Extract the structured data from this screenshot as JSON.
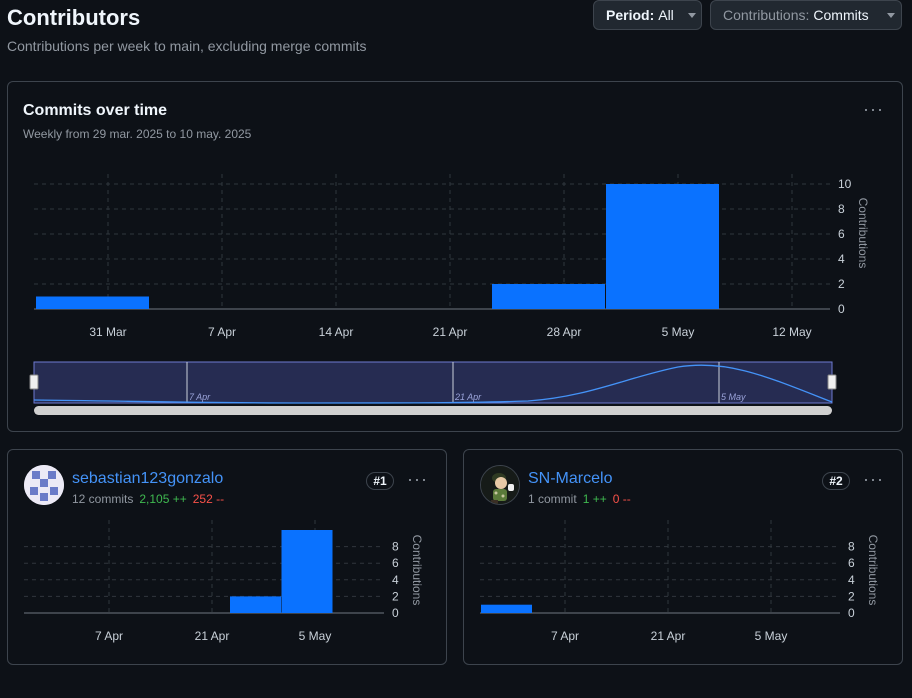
{
  "header": {
    "title": "Contributors",
    "subtitle": "Contributions per week to main, excluding merge commits",
    "period_label": "Period:",
    "period_value": "All",
    "contrib_label": "Contributions:",
    "contrib_value": "Commits"
  },
  "overview": {
    "title": "Commits over time",
    "subtitle": "Weekly from 29 mar. 2025 to 10 may. 2025",
    "more_icon": "kebab-horizontal-icon"
  },
  "chart_data": [
    {
      "type": "bar",
      "title": "Commits over time",
      "categories": [
        "31 Mar",
        "7 Apr",
        "14 Apr",
        "21 Apr",
        "28 Apr",
        "5 May"
      ],
      "values": [
        1,
        0,
        0,
        0,
        2,
        10
      ],
      "x_tick_labels": [
        "31 Mar",
        "7 Apr",
        "14 Apr",
        "21 Apr",
        "28 Apr",
        "5 May",
        "12 May"
      ],
      "y_ticks": [
        0,
        2,
        4,
        6,
        8,
        10
      ],
      "ylabel": "Contributions",
      "ylim": [
        0,
        10
      ],
      "grid": true,
      "navigator_labels": [
        "7 Apr",
        "21 Apr",
        "5 May"
      ],
      "bar_color": "#0a72ff"
    },
    {
      "type": "bar",
      "title": "",
      "contributor": "sebastian123gonzalo",
      "x_tick_labels": [
        "7 Apr",
        "21 Apr",
        "5 May"
      ],
      "values": [
        0,
        0,
        0,
        0,
        2,
        10
      ],
      "y_ticks": [
        0,
        2,
        4,
        6,
        8
      ],
      "ylabel": "Contributions",
      "ylim": [
        0,
        10
      ],
      "grid": true
    },
    {
      "type": "bar",
      "title": "",
      "contributor": "SN-Marcelo",
      "x_tick_labels": [
        "7 Apr",
        "21 Apr",
        "5 May"
      ],
      "values": [
        1,
        0,
        0,
        0,
        0,
        0
      ],
      "y_ticks": [
        0,
        2,
        4,
        6,
        8
      ],
      "ylabel": "Contributions",
      "ylim": [
        0,
        10
      ],
      "grid": true
    }
  ],
  "contributors": [
    {
      "name": "sebastian123gonzalo",
      "commits": "12 commits",
      "additions": "2,105 ++",
      "deletions": "252 --",
      "rank": "#1",
      "avatar_icon": "identicon-avatar"
    },
    {
      "name": "SN-Marcelo",
      "commits": "1 commit",
      "additions": "1 ++",
      "deletions": "0 --",
      "rank": "#2",
      "avatar_icon": "cartoon-avatar"
    }
  ],
  "colors": {
    "bar": "#0a72ff",
    "link": "#4493f8",
    "additions": "#3fb950",
    "deletions": "#f85149",
    "background": "#0d1117",
    "border": "#3d444d"
  }
}
